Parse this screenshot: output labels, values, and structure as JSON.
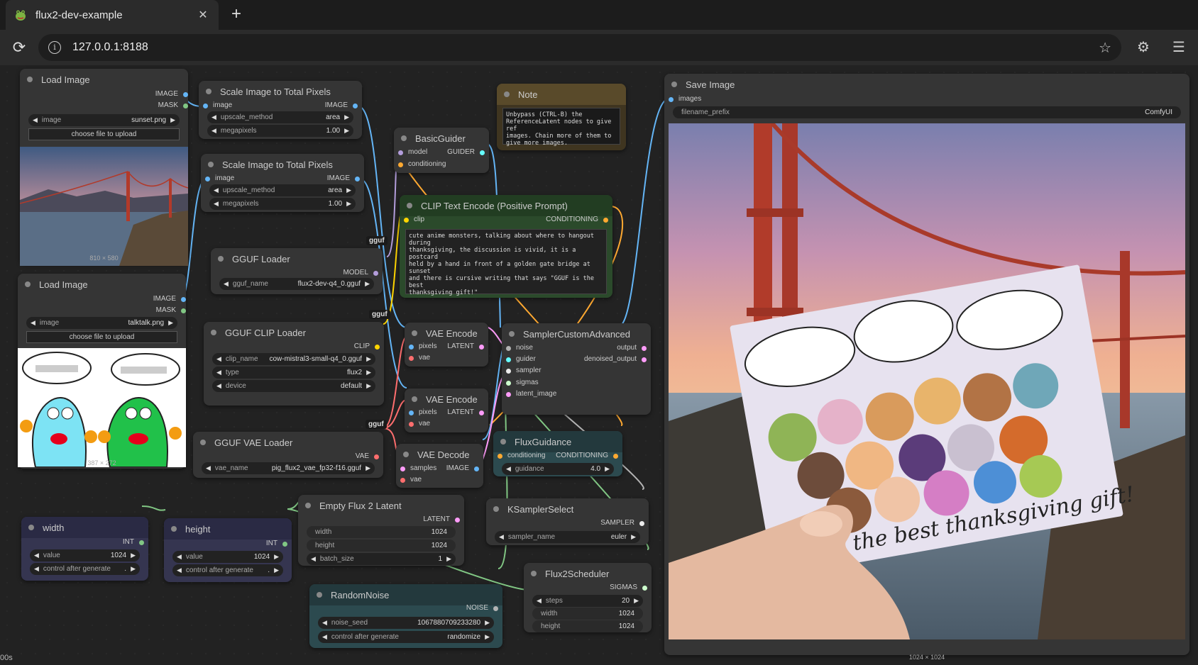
{
  "browser": {
    "tab_title": "flux2-dev-example",
    "url": "127.0.0.1:8188",
    "new_tab": "+",
    "close_tab": "✕"
  },
  "status": {
    "time": "00s"
  },
  "nodes": {
    "load_image_1": {
      "title": "Load Image",
      "out_image": "IMAGE",
      "out_mask": "MASK",
      "widget_label": "image",
      "widget_value": "sunset.png",
      "upload": "choose file to upload",
      "dims": "810 × 580"
    },
    "load_image_2": {
      "title": "Load Image",
      "out_image": "IMAGE",
      "out_mask": "MASK",
      "widget_label": "image",
      "widget_value": "talktalk.png",
      "upload": "choose file to upload",
      "dims": "387 × 272"
    },
    "scale_1": {
      "title": "Scale Image to Total Pixels",
      "in_image": "image",
      "out_image": "IMAGE",
      "w1_label": "upscale_method",
      "w1_value": "area",
      "w2_label": "megapixels",
      "w2_value": "1.00"
    },
    "scale_2": {
      "title": "Scale Image to Total Pixels",
      "in_image": "image",
      "out_image": "IMAGE",
      "w1_label": "upscale_method",
      "w1_value": "area",
      "w2_label": "megapixels",
      "w2_value": "1.00"
    },
    "gguf_loader": {
      "title": "GGUF Loader",
      "out_model": "MODEL",
      "w_label": "gguf_name",
      "w_value": "flux2-dev-q4_0.gguf",
      "badge": "gguf"
    },
    "gguf_clip": {
      "title": "GGUF CLIP Loader",
      "out_clip": "CLIP",
      "w1_label": "clip_name",
      "w1_value": "cow-mistral3-small-q4_0.gguf",
      "w2_label": "type",
      "w2_value": "flux2",
      "w3_label": "device",
      "w3_value": "default",
      "badge": "gguf"
    },
    "gguf_vae": {
      "title": "GGUF VAE Loader",
      "out_vae": "VAE",
      "w_label": "vae_name",
      "w_value": "pig_flux2_vae_fp32-f16.gguf",
      "badge": "gguf"
    },
    "basic_guider": {
      "title": "BasicGuider",
      "in_model": "model",
      "in_cond": "conditioning",
      "out": "GUIDER"
    },
    "note": {
      "title": "Note",
      "text": "Unbypass (CTRL-B) the\nReferenceLatent nodes to give ref\nimages. Chain more of them to\ngive more images."
    },
    "clip_text": {
      "title": "CLIP Text Encode (Positive Prompt)",
      "in_clip": "clip",
      "out": "CONDITIONING",
      "text": "cute anime monsters, talking about where to hangout during\nthanksgiving, the discussion is vivid, it is a postcard\nheld by a hand in front of a golden gate bridge at sunset\nand there is cursive writing that says \"GGUF is the best\nthanksgiving gift!\""
    },
    "vae_encode_1": {
      "title": "VAE Encode",
      "in_pixels": "pixels",
      "in_vae": "vae",
      "out": "LATENT"
    },
    "vae_encode_2": {
      "title": "VAE Encode",
      "in_pixels": "pixels",
      "in_vae": "vae",
      "out": "LATENT"
    },
    "vae_decode": {
      "title": "VAE Decode",
      "in_samples": "samples",
      "in_vae": "vae",
      "out": "IMAGE"
    },
    "sampler_adv": {
      "title": "SamplerCustomAdvanced",
      "in_noise": "noise",
      "in_guider": "guider",
      "in_sampler": "sampler",
      "in_sigmas": "sigmas",
      "in_latent": "latent_image",
      "out_output": "output",
      "out_denoised": "denoised_output"
    },
    "flux_guidance": {
      "title": "FluxGuidance",
      "in_cond": "conditioning",
      "out": "CONDITIONING",
      "w_label": "guidance",
      "w_value": "4.0"
    },
    "empty_latent": {
      "title": "Empty Flux 2 Latent",
      "out": "LATENT",
      "w1_label": "width",
      "w1_value": "1024",
      "w2_label": "height",
      "w2_value": "1024",
      "w3_label": "batch_size",
      "w3_value": "1"
    },
    "ksampler_select": {
      "title": "KSamplerSelect",
      "out": "SAMPLER",
      "w_label": "sampler_name",
      "w_value": "euler"
    },
    "flux2_sched": {
      "title": "Flux2Scheduler",
      "out": "SIGMAS",
      "w1_label": "steps",
      "w1_value": "20",
      "w2_label": "width",
      "w2_value": "1024",
      "w3_label": "height",
      "w3_value": "1024"
    },
    "random_noise": {
      "title": "RandomNoise",
      "out": "NOISE",
      "w1_label": "noise_seed",
      "w1_value": "1067880709233280",
      "w2_label": "control after generate",
      "w2_value": "randomize"
    },
    "width": {
      "title": "width",
      "out": "INT",
      "w1_label": "value",
      "w1_value": "1024",
      "w2_label": "control after generate",
      "w2_value": "."
    },
    "height": {
      "title": "height",
      "out": "INT",
      "w1_label": "value",
      "w1_value": "1024",
      "w2_label": "control after generate",
      "w2_value": "."
    },
    "save_image": {
      "title": "Save Image",
      "in_images": "images",
      "w_label": "filename_prefix",
      "w_value": "ComfyUI",
      "dims": "1024 × 1024",
      "card_text": "GGUF is the best thanksgiving gift!"
    }
  },
  "colors": {
    "image": "#64b5f6",
    "mask": "#81c784",
    "model": "#b39ddb",
    "clip": "#ffd500",
    "vae": "#ff6e6e",
    "cond": "#ffa931",
    "latent": "#ff9cf9",
    "int": "#81c784",
    "accent": "#353535"
  },
  "icons": {
    "favicon": "comfy-frog-icon",
    "reload": "reload-icon",
    "info": "info-icon",
    "star": "bookmark-star-icon",
    "extensions": "extensions-icon",
    "favorites": "favorites-icon"
  }
}
